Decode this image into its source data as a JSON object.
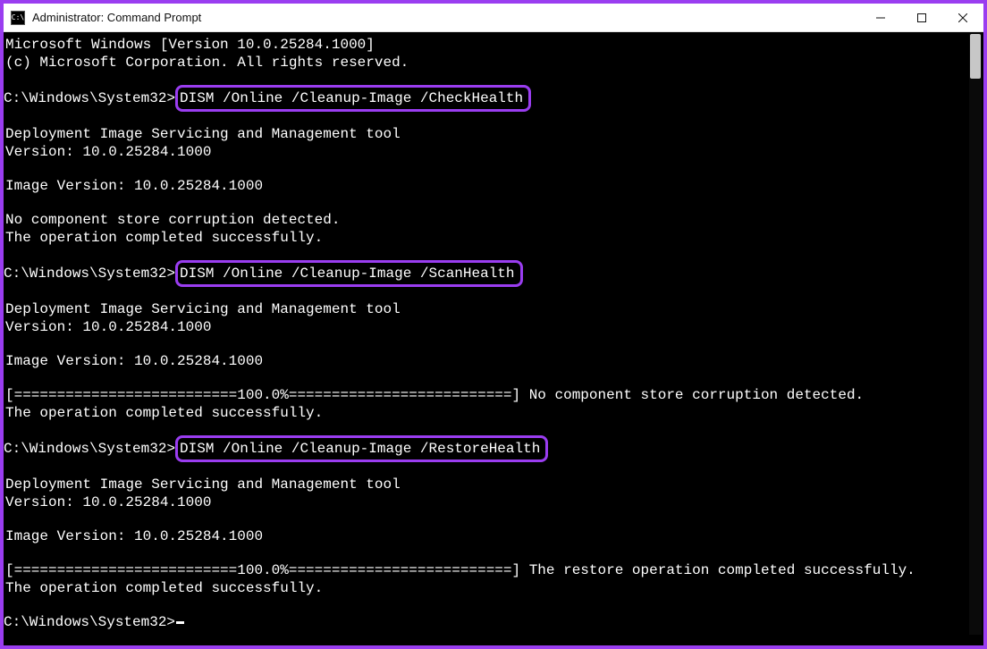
{
  "colors": {
    "accent_border": "#9a3df0",
    "terminal_bg": "#000000",
    "terminal_fg": "#ffffff",
    "titlebar_bg": "#ffffff",
    "titlebar_fg": "#111111"
  },
  "title_bar": {
    "icon_label": "CMD",
    "title": "Administrator: Command Prompt",
    "minimize_icon": "minimize-icon",
    "maximize_icon": "maximize-icon",
    "close_icon": "close-icon"
  },
  "terminal": {
    "header": {
      "line1": "Microsoft Windows [Version 10.0.25284.1000]",
      "line2": "(c) Microsoft Corporation. All rights reserved."
    },
    "prompt_path": "C:\\Windows\\System32",
    "prompt_glyph": ">",
    "blocks": [
      {
        "cmd": "DISM /Online /Cleanup-Image /CheckHealth",
        "tool_line": "Deployment Image Servicing and Management tool",
        "version_line": "Version: 10.0.25284.1000",
        "image_version_line": "Image Version: 10.0.25284.1000",
        "progress": "",
        "result_line": "No component store corruption detected.",
        "completed_line": "The operation completed successfully."
      },
      {
        "cmd": "DISM /Online /Cleanup-Image /ScanHealth",
        "tool_line": "Deployment Image Servicing and Management tool",
        "version_line": "Version: 10.0.25284.1000",
        "image_version_line": "Image Version: 10.0.25284.1000",
        "progress": "[==========================100.0%==========================] No component store corruption detected.",
        "result_line": "",
        "completed_line": "The operation completed successfully."
      },
      {
        "cmd": "DISM /Online /Cleanup-Image /RestoreHealth",
        "tool_line": "Deployment Image Servicing and Management tool",
        "version_line": "Version: 10.0.25284.1000",
        "image_version_line": "Image Version: 10.0.25284.1000",
        "progress": "[==========================100.0%==========================] The restore operation completed successfully.",
        "result_line": "",
        "completed_line": "The operation completed successfully."
      }
    ],
    "final_prompt": "C:\\Windows\\System32>"
  }
}
